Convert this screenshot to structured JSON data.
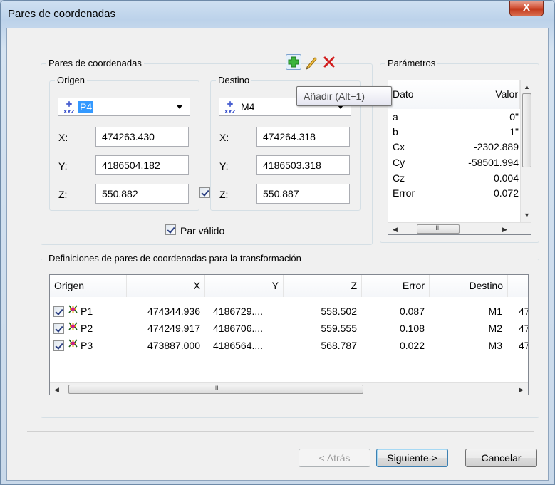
{
  "window": {
    "title": "Pares de coordenadas",
    "close_glyph": "X"
  },
  "pairs_group": {
    "title": "Pares de coordenadas",
    "origin": {
      "title": "Origen",
      "point": "P4",
      "x_label": "X:",
      "x": "474263.430",
      "y_label": "Y:",
      "y": "4186504.182",
      "z_label": "Z:",
      "z": "550.882"
    },
    "dest": {
      "title": "Destino",
      "point": "M4",
      "x_label": "X:",
      "x": "474264.318",
      "y_label": "Y:",
      "y": "4186503.318",
      "z_label": "Z:",
      "z": "550.887"
    },
    "valid_label": "Par válido",
    "tooltip": "Añadir (Alt+1)",
    "icons": [
      "add-icon",
      "edit-icon",
      "delete-icon"
    ]
  },
  "params": {
    "title": "Parámetros",
    "headers": [
      "Dato",
      "Valor"
    ],
    "rows": [
      {
        "name": "a",
        "value": "0\""
      },
      {
        "name": "b",
        "value": "1\""
      },
      {
        "name": "Cx",
        "value": "-2302.889"
      },
      {
        "name": "Cy",
        "value": "-58501.994"
      },
      {
        "name": "Cz",
        "value": "0.004"
      },
      {
        "name": "Error",
        "value": "0.072"
      }
    ]
  },
  "definitions": {
    "title": "Definiciones de pares de coordenadas para la transformación",
    "headers": [
      "Origen",
      "X",
      "Y",
      "Z",
      "Error",
      "Destino"
    ],
    "rows": [
      {
        "origin": "P1",
        "x": "474344.936",
        "y": "4186729....",
        "z": "558.502",
        "error": "0.087",
        "dest": "M1",
        "extra": "47"
      },
      {
        "origin": "P2",
        "x": "474249.917",
        "y": "4186706....",
        "z": "559.555",
        "error": "0.108",
        "dest": "M2",
        "extra": "47"
      },
      {
        "origin": "P3",
        "x": "473887.000",
        "y": "4186564....",
        "z": "568.787",
        "error": "0.022",
        "dest": "M3",
        "extra": "47"
      }
    ],
    "scroll_grip": "III"
  },
  "buttons": {
    "back": "< Atrás",
    "next": "Siguiente >",
    "cancel": "Cancelar"
  },
  "colors": {
    "accent": "#3399ff",
    "add": "#3cb43c",
    "delete": "#d21e1e"
  }
}
